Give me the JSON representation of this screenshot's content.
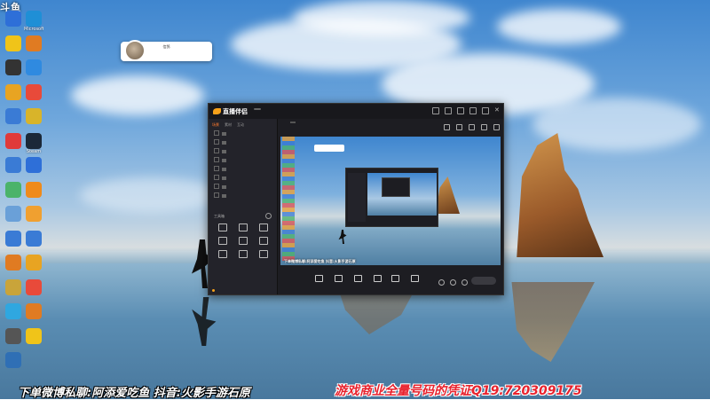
{
  "desktop": {
    "corner_logo": "斗鱼",
    "icons": [
      {
        "label": "",
        "color": "#2e6fd8"
      },
      {
        "label": "",
        "color": "#f0c419"
      },
      {
        "label": "",
        "color": "#333333"
      },
      {
        "label": "",
        "color": "#e8a422"
      },
      {
        "label": "",
        "color": "#3a7bd5"
      },
      {
        "label": "",
        "color": "#e03a3a"
      },
      {
        "label": "",
        "color": "#3a7bd5"
      },
      {
        "label": "",
        "color": "#4bb36a"
      },
      {
        "label": "",
        "color": "#6aa0d8"
      },
      {
        "label": "",
        "color": "#3a7bd5"
      },
      {
        "label": "",
        "color": "#e07b22"
      },
      {
        "label": "",
        "color": "#c9a43a"
      },
      {
        "label": "",
        "color": "#2fa7e0"
      },
      {
        "label": "",
        "color": "#555555"
      },
      {
        "label": "",
        "color": "#2f6fb5"
      },
      {
        "label": "Microsoft Edge",
        "color": "#1f8fd6"
      },
      {
        "label": "",
        "color": "#e07b22"
      },
      {
        "label": "",
        "color": "#2f8ae0"
      },
      {
        "label": "",
        "color": "#e84a3a"
      },
      {
        "label": "",
        "color": "#d8b42a"
      },
      {
        "label": "Steam",
        "color": "#1b2838"
      },
      {
        "label": "",
        "color": "#2e6fd8"
      },
      {
        "label": "",
        "color": "#ef8a1a"
      },
      {
        "label": "",
        "color": "#f0a030"
      },
      {
        "label": "",
        "color": "#3a7bd5"
      },
      {
        "label": "",
        "color": "#e8a422"
      },
      {
        "label": "",
        "color": "#e84a3a"
      },
      {
        "label": "",
        "color": "#e07b22"
      },
      {
        "label": "",
        "color": "#f0c419"
      }
    ],
    "notification": {
      "name": "信鸽",
      "text": ""
    }
  },
  "app": {
    "title": "直播伴侣",
    "version": "",
    "left_tabs": [
      "场景",
      "素材",
      "互动"
    ],
    "left_rows": [
      "",
      "",
      "",
      "",
      "",
      "",
      "",
      ""
    ],
    "tools_title": "工具箱",
    "tools": [
      "",
      "",
      "",
      "",
      "",
      "",
      "",
      "",
      ""
    ],
    "footer": "",
    "main_tabs": [
      "",
      "",
      ""
    ],
    "main_sub": [
      "",
      "",
      ""
    ],
    "preview_subtitle": "下单微博私聊:阿添爱吃鱼 抖音:火影手游石原",
    "bottom_items": [
      "",
      "",
      "",
      "",
      "",
      ""
    ],
    "go_live": ""
  },
  "subtitles": {
    "left": "下单微博私聊:阿添爱吃鱼 抖音:火影手游石原",
    "right": "游戏商业全量号码的凭证Q19:720309175"
  },
  "colors": {
    "accent": "#f7a21b",
    "subtitle_red": "#e8222d"
  }
}
